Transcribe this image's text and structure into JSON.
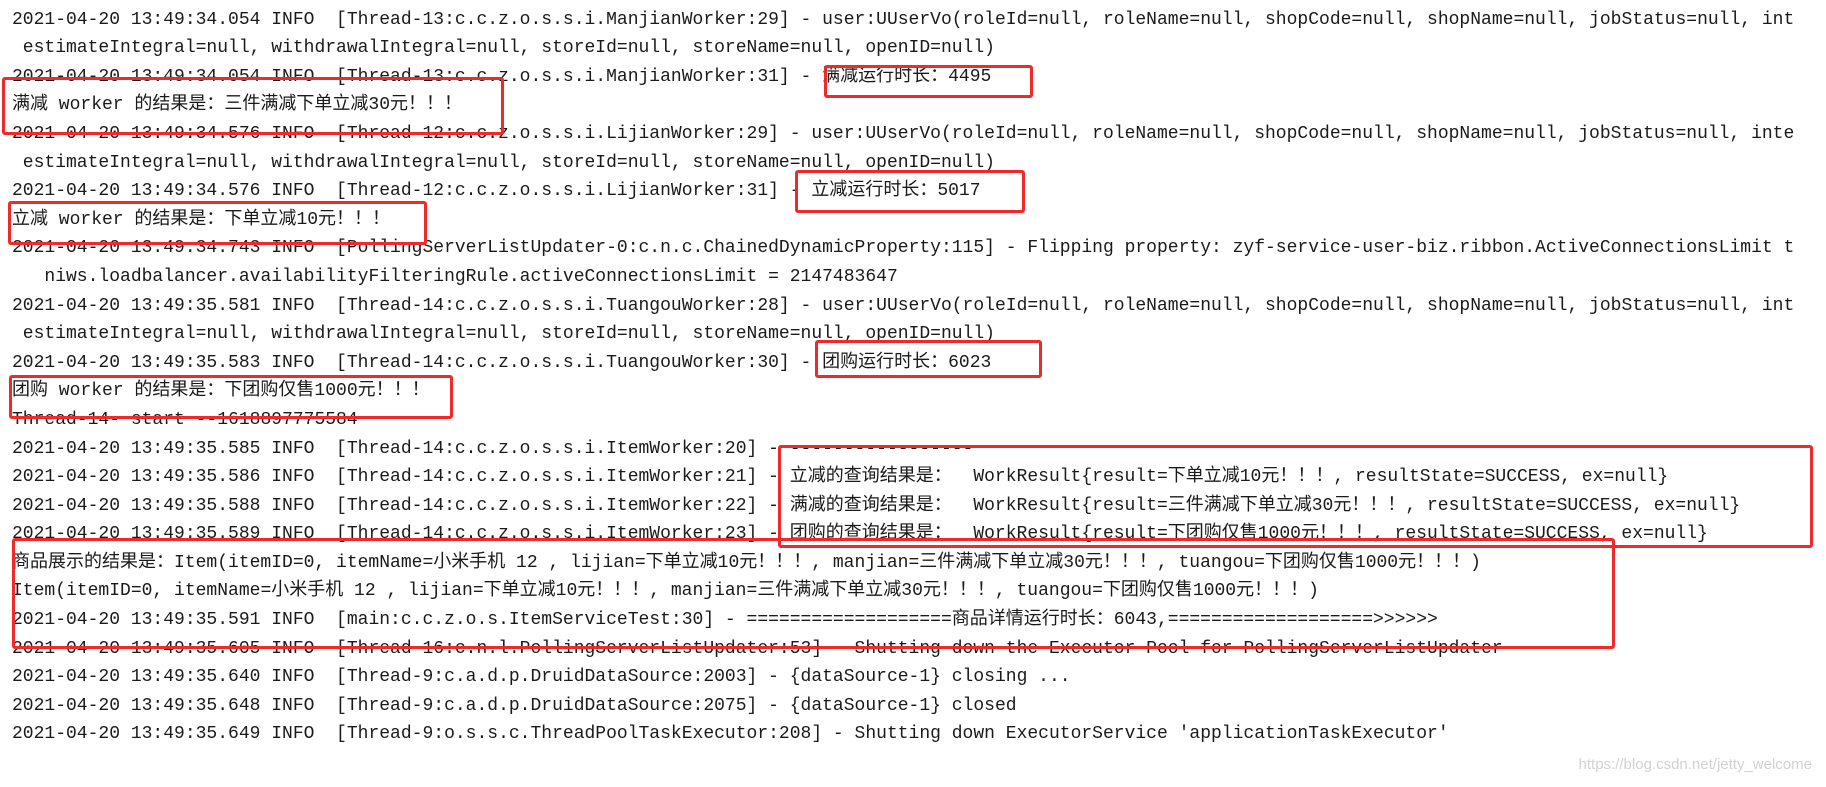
{
  "console": {
    "lines": [
      "}}",
      "2021-04-20 13:49:34.054 INFO  [Thread-13:c.c.z.o.s.s.i.ManjianWorker:29] - user:UUserVo(roleId=null, roleName=null, shopCode=null, shopName=null, jobStatus=null, int",
      " estimateIntegral=null, withdrawalIntegral=null, storeId=null, storeName=null, openID=null)",
      "2021-04-20 13:49:34.054 INFO  [Thread-13:c.c.z.o.s.s.i.ManjianWorker:31] - 满减运行时长：4495",
      "满减 worker 的结果是：三件满减下单立减30元！！！",
      "2021-04-20 13:49:34.576 INFO  [Thread-12:c.c.z.o.s.s.i.LijianWorker:29] - user:UUserVo(roleId=null, roleName=null, shopCode=null, shopName=null, jobStatus=null, inte",
      " estimateIntegral=null, withdrawalIntegral=null, storeId=null, storeName=null, openID=null)",
      "2021-04-20 13:49:34.576 INFO  [Thread-12:c.c.z.o.s.s.i.LijianWorker:31] - 立减运行时长：5017",
      "立减 worker 的结果是：下单立减10元！！！",
      "2021-04-20 13:49:34.743 INFO  [PollingServerListUpdater-0:c.n.c.ChainedDynamicProperty:115] - Flipping property: zyf-service-user-biz.ribbon.ActiveConnectionsLimit t",
      "   niws.loadbalancer.availabilityFilteringRule.activeConnectionsLimit = 2147483647",
      "2021-04-20 13:49:35.581 INFO  [Thread-14:c.c.z.o.s.s.i.TuangouWorker:28] - user:UUserVo(roleId=null, roleName=null, shopCode=null, shopName=null, jobStatus=null, int",
      " estimateIntegral=null, withdrawalIntegral=null, storeId=null, storeName=null, openID=null)",
      "2021-04-20 13:49:35.583 INFO  [Thread-14:c.c.z.o.s.s.i.TuangouWorker:30] - 团购运行时长：6023",
      "团购 worker 的结果是：下团购仅售1000元！！！",
      "Thread-14- start --1618897775584",
      "2021-04-20 13:49:35.585 INFO  [Thread-14:c.c.z.o.s.s.i.ItemWorker:20] - -----------------",
      "2021-04-20 13:49:35.586 INFO  [Thread-14:c.c.z.o.s.s.i.ItemWorker:21] - 立减的查询结果是：  WorkResult{result=下单立减10元！！！, resultState=SUCCESS, ex=null}",
      "2021-04-20 13:49:35.588 INFO  [Thread-14:c.c.z.o.s.s.i.ItemWorker:22] - 满减的查询结果是：  WorkResult{result=三件满减下单立减30元！！！, resultState=SUCCESS, ex=null}",
      "2021-04-20 13:49:35.589 INFO  [Thread-14:c.c.z.o.s.s.i.ItemWorker:23] - 团购的查询结果是：  WorkResult{result=下团购仅售1000元！！！, resultState=SUCCESS, ex=null}",
      "商品展示的结果是：Item(itemID=0, itemName=小米手机 12 , lijian=下单立减10元！！！, manjian=三件满减下单立减30元！！！, tuangou=下团购仅售1000元！！！)",
      "Item(itemID=0, itemName=小米手机 12 , lijian=下单立减10元！！！, manjian=三件满减下单立减30元！！！, tuangou=下团购仅售1000元！！！)",
      "2021-04-20 13:49:35.591 INFO  [main:c.c.z.o.s.ItemServiceTest:30] - ===================商品详情运行时长：6043,===================>>>>>>",
      "2021-04-20 13:49:35.605 INFO  [Thread-16:c.n.l.PollingServerListUpdater:53] - Shutting down the Executor Pool for PollingServerListUpdater",
      "2021-04-20 13:49:35.640 INFO  [Thread-9:c.a.d.p.DruidDataSource:2003] - {dataSource-1} closing ...",
      "2021-04-20 13:49:35.648 INFO  [Thread-9:c.a.d.p.DruidDataSource:2075] - {dataSource-1} closed",
      "2021-04-20 13:49:35.649 INFO  [Thread-9:o.s.s.c.ThreadPoolTaskExecutor:208] - Shutting down ExecutorService 'applicationTaskExecutor'"
    ]
  },
  "annotation_color": "#f02a2a",
  "watermark": "https://blog.csdn.net/jetty_welcome"
}
